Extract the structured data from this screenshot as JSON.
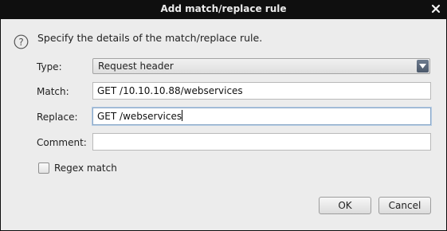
{
  "window": {
    "title": "Add match/replace rule",
    "close_icon": "close-icon"
  },
  "dialog": {
    "description": "Specify the details of the match/replace rule.",
    "help_icon": "question-circle-icon",
    "type": {
      "label": "Type:",
      "selected": "Request header",
      "dropdown_icon": "chevron-down-icon"
    },
    "match": {
      "label": "Match:",
      "value": "GET /10.10.10.88/webservices"
    },
    "replace": {
      "label": "Replace:",
      "value": "GET /webservices"
    },
    "comment": {
      "label": "Comment:",
      "value": ""
    },
    "regex": {
      "label": "Regex match",
      "checked": false
    },
    "buttons": {
      "ok": "OK",
      "cancel": "Cancel"
    }
  }
}
